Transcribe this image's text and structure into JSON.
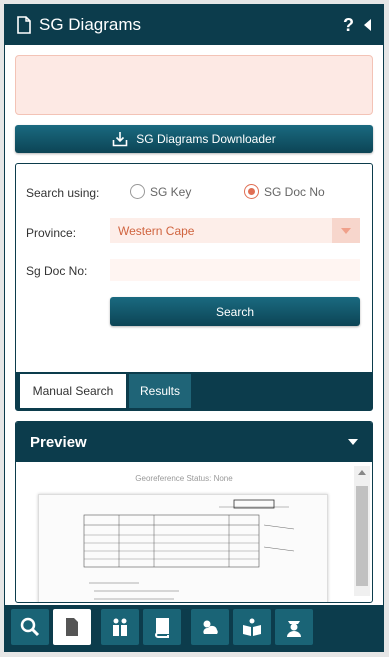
{
  "header": {
    "title": "SG Diagrams",
    "help": "?",
    "icons": {
      "doc": "document-icon",
      "collapse": "collapse-left-icon"
    }
  },
  "downloader": {
    "label": "SG Diagrams Downloader",
    "icon": "download-tray-icon"
  },
  "search_form": {
    "search_using_label": "Search using:",
    "options": [
      {
        "label": "SG Key",
        "checked": false
      },
      {
        "label": "SG Doc No",
        "checked": true
      }
    ],
    "province_label": "Province:",
    "province_value": "Western Cape",
    "docno_label": "Sg Doc No:",
    "docno_value": "",
    "search_button": "Search",
    "tabs": [
      {
        "label": "Manual Search",
        "active": true
      },
      {
        "label": "Results",
        "active": false
      }
    ]
  },
  "preview": {
    "title": "Preview",
    "georef_status": "Georeference Status: None"
  },
  "bottom_nav": [
    {
      "icon": "search-icon",
      "active": false
    },
    {
      "icon": "document-icon",
      "active": true
    },
    {
      "icon": "people-icon",
      "active": false
    },
    {
      "icon": "book-icon",
      "active": false
    },
    {
      "icon": "weather-icon",
      "active": false
    },
    {
      "icon": "open-book-icon",
      "active": false
    },
    {
      "icon": "officer-icon",
      "active": false
    }
  ],
  "colors": {
    "primary": "#0c3c4c",
    "accent": "#e06e53",
    "alert_bg": "#fde9e4"
  }
}
